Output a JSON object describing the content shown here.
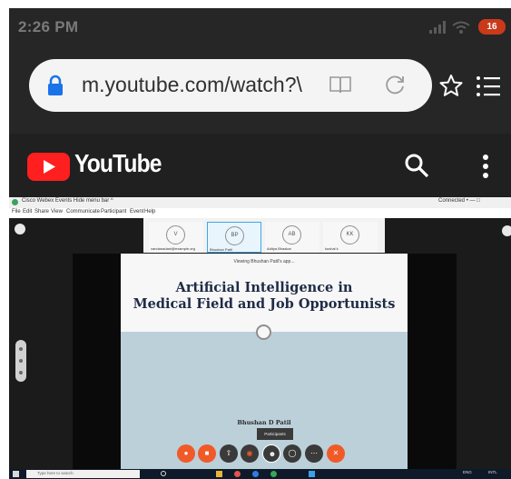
{
  "status_bar": {
    "time": "2:26 PM",
    "battery": "16"
  },
  "browser": {
    "url": "m.youtube.com/watch?\\"
  },
  "youtube": {
    "logo_text": "YouTube"
  },
  "webex": {
    "window_title": "Cisco Webex Events   Hide menu bar ^",
    "connected": "Connected  •  —  □",
    "menu": [
      "File",
      "Edit",
      "Share",
      "View",
      "Communicate",
      "Participant",
      "Event",
      "Help"
    ],
    "participants": [
      {
        "initials": "V",
        "name": "vandanadani@example.org"
      },
      {
        "initials": "BP",
        "name": "Bhushan Patil"
      },
      {
        "initials": "AB",
        "name": "Aditya Bhaskar"
      },
      {
        "initials": "KK",
        "name": "kushal k"
      }
    ],
    "viewing_text": "Viewing Bhushan Patil's app...",
    "slide_title_line1": "Artificial Intelligence in",
    "slide_title_line2": "Medical Field and Job Opportunists",
    "slide_author": "Bhushan D Patil",
    "tooltip": "Participants",
    "taskbar_search": "Type here to search",
    "taskbar_lang": "ENG",
    "taskbar_time": "INTL"
  },
  "colors": {
    "status_bg": "#262626",
    "chrome_bg": "#262626",
    "youtube_bg": "#202020",
    "youtube_red": "#ff1f1f",
    "lock_blue": "#1a73e8",
    "webex_active_border": "#3ca8e6",
    "control_orange": "#f05a28"
  },
  "icons": [
    "lock-icon",
    "reader-mode-icon",
    "reload-icon",
    "star-icon",
    "menu-icon",
    "search-icon",
    "more-vert-icon",
    "youtube-play-icon"
  ]
}
